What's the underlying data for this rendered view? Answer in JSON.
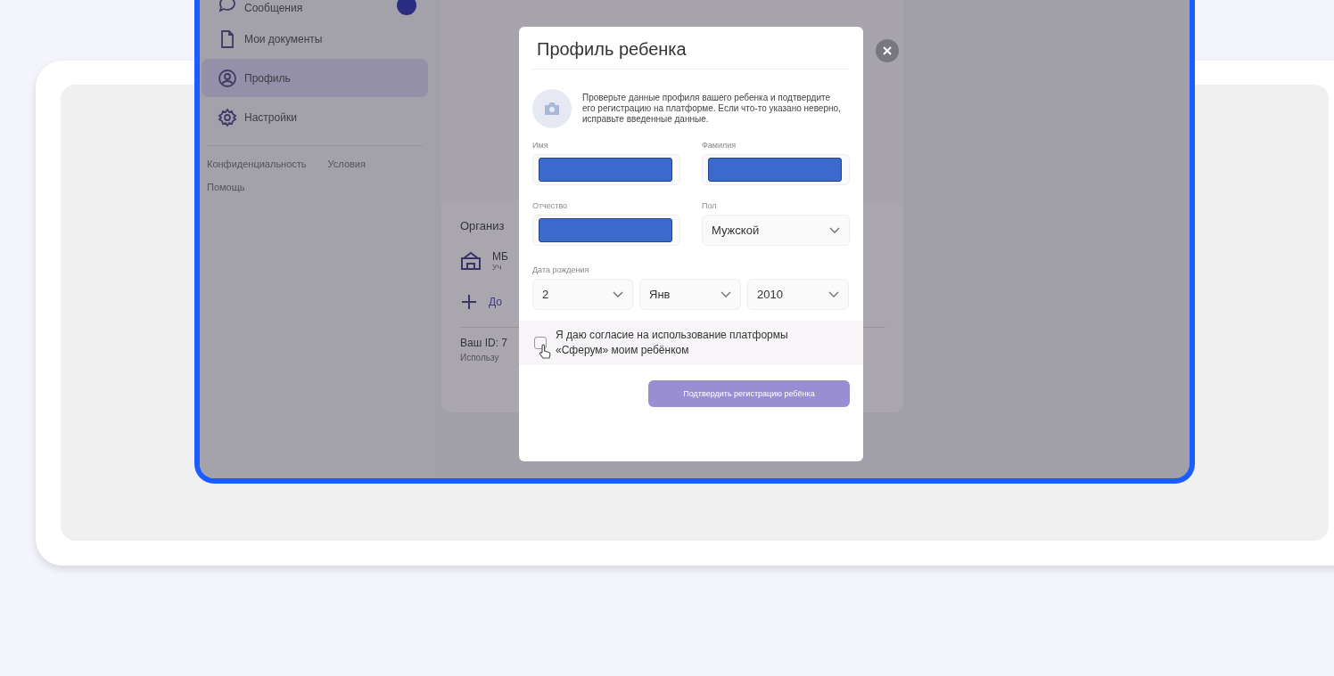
{
  "sidebar": {
    "items": [
      {
        "label": "Сообщения",
        "selected": false,
        "badge": true
      },
      {
        "label": "Мои документы",
        "selected": false,
        "badge": false
      },
      {
        "label": "Профиль",
        "selected": true,
        "badge": false
      },
      {
        "label": "Настройки",
        "selected": false,
        "badge": false
      }
    ],
    "footer_links": [
      "Конфиденциальность",
      "Условия",
      "Помощь"
    ]
  },
  "organization_card": {
    "heading": "Организ",
    "org_name": "МБ",
    "org_type": "Уч",
    "add_label": "До",
    "id_text": "Ваш ID: 7",
    "hint": "Использу"
  },
  "modal": {
    "title": "Профиль ребенка",
    "description": "Проверьте данные профиля вашего ребенка и подтвердите его регистрацию на платформе. Если что-то указано неверно, исправьте введенные данные.",
    "fields": [
      {
        "label": "Имя",
        "kind": "redacted"
      },
      {
        "label": "Фамилия",
        "kind": "redacted"
      },
      {
        "label": "Отчество",
        "kind": "redacted"
      },
      {
        "label": "Пол",
        "kind": "select",
        "value": "Мужской"
      }
    ],
    "birth_date": {
      "label": "Дата рождения",
      "parts": [
        "2",
        "Янв",
        "2010"
      ]
    },
    "consent": {
      "label": "Я даю согласие на использование платформы «Сферум» моим ребёнком",
      "checked": false
    },
    "submit": "Подтвердить регистрацию ребёнка"
  }
}
